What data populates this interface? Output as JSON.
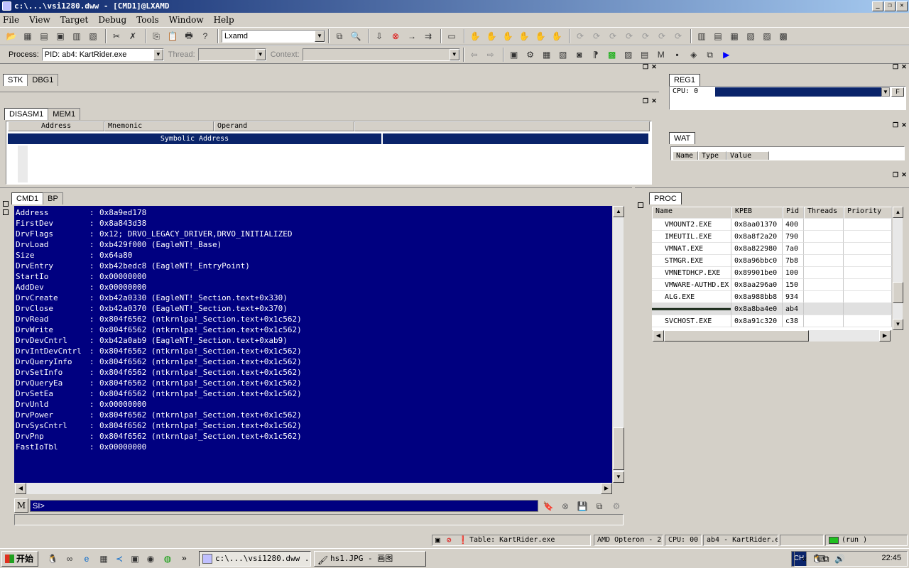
{
  "window": {
    "title": "c:\\...\\vsi1280.dww - [CMD1]@LXAMD"
  },
  "menu": [
    "File",
    "View",
    "Target",
    "Debug",
    "Tools",
    "Window",
    "Help"
  ],
  "toolbar1": {
    "target_combo": "Lxamd"
  },
  "toolbar2": {
    "process_label": "Process:",
    "process_value": "PID:  ab4: KartRider.exe",
    "thread_label": "Thread:",
    "context_label": "Context:"
  },
  "stk_pane": {
    "tabs": [
      "STK",
      "DBG1"
    ]
  },
  "disasm_pane": {
    "tabs": [
      "DISASM1",
      "MEM1"
    ],
    "columns": [
      "Address",
      "Mnemonic",
      "Operand"
    ],
    "symbolic_header": "Symbolic Address"
  },
  "reg_pane": {
    "tab": "REG1",
    "cpu_label": "CPU:  0",
    "f_button": "F"
  },
  "wat_pane": {
    "tab": "WAT",
    "columns": [
      "Name",
      "Type",
      "Value"
    ]
  },
  "cmd_pane": {
    "tabs": [
      "CMD1",
      "BP"
    ],
    "lines": [
      {
        "key": "Address",
        "value": "0x8a9ed178"
      },
      {
        "key": "FirstDev",
        "value": "0x8a843d38"
      },
      {
        "key": "DrvFlags",
        "value": "0x12; DRVO_LEGACY_DRIVER,DRVO_INITIALIZED"
      },
      {
        "key": "DrvLoad",
        "value": "0xb429f000 (EagleNT!_Base)"
      },
      {
        "key": "Size",
        "value": "0x64a80"
      },
      {
        "key": "DrvEntry",
        "value": "0xb42bedc8 (EagleNT!_EntryPoint)"
      },
      {
        "key": "StartIo",
        "value": "0x00000000"
      },
      {
        "key": "AddDev",
        "value": "0x00000000"
      },
      {
        "key": "DrvCreate",
        "value": "0xb42a0330 (EagleNT!_Section.text+0x330)"
      },
      {
        "key": "DrvClose",
        "value": "0xb42a0370 (EagleNT!_Section.text+0x370)"
      },
      {
        "key": "DrvRead",
        "value": "0x804f6562 (ntkrnlpa!_Section.text+0x1c562)"
      },
      {
        "key": "DrvWrite",
        "value": "0x804f6562 (ntkrnlpa!_Section.text+0x1c562)"
      },
      {
        "key": "DrvDevCntrl",
        "value": "0xb42a0ab9 (EagleNT!_Section.text+0xab9)"
      },
      {
        "key": "DrvIntDevCntrl",
        "value": "0x804f6562 (ntkrnlpa!_Section.text+0x1c562)"
      },
      {
        "key": "DrvQueryInfo",
        "value": "0x804f6562 (ntkrnlpa!_Section.text+0x1c562)"
      },
      {
        "key": "DrvSetInfo",
        "value": "0x804f6562 (ntkrnlpa!_Section.text+0x1c562)"
      },
      {
        "key": "DrvQueryEa",
        "value": "0x804f6562 (ntkrnlpa!_Section.text+0x1c562)"
      },
      {
        "key": "DrvSetEa",
        "value": "0x804f6562 (ntkrnlpa!_Section.text+0x1c562)"
      },
      {
        "key": "DrvUnld",
        "value": "0x00000000"
      },
      {
        "key": "DrvPower",
        "value": "0x804f6562 (ntkrnlpa!_Section.text+0x1c562)"
      },
      {
        "key": "DrvSysCntrl",
        "value": "0x804f6562 (ntkrnlpa!_Section.text+0x1c562)"
      },
      {
        "key": "DrvPnp",
        "value": "0x804f6562 (ntkrnlpa!_Section.text+0x1c562)"
      },
      {
        "key": "FastIoTbl",
        "value": "0x00000000"
      }
    ],
    "separator": ":",
    "input_value": "SI>",
    "m_button": "M"
  },
  "proc_pane": {
    "tab": "PROC",
    "columns": [
      "Name",
      "KPEB",
      "Pid",
      "Threads",
      "Priority"
    ],
    "rows": [
      {
        "name": "VMOUNT2.EXE",
        "kpeb": "0x8aa01370",
        "pid": "400"
      },
      {
        "name": "IMEUTIL.EXE",
        "kpeb": "0x8a8f2a20",
        "pid": "790"
      },
      {
        "name": "VMNAT.EXE",
        "kpeb": "0x8a822980",
        "pid": "7a0"
      },
      {
        "name": "STMGR.EXE",
        "kpeb": "0x8a96bbc0",
        "pid": "7b8"
      },
      {
        "name": "VMNETDHCP.EXE",
        "kpeb": "0x89901be0",
        "pid": "100"
      },
      {
        "name": "VMWARE-AUTHD.EX",
        "kpeb": "0x8aa296a0",
        "pid": "150"
      },
      {
        "name": "ALG.EXE",
        "kpeb": "0x8a988bb8",
        "pid": "934"
      },
      {
        "name": "",
        "kpeb": "0x8a8ba4e0",
        "pid": "ab4"
      },
      {
        "name": "SVCHOST.EXE",
        "kpeb": "0x8a91c320",
        "pid": "c38"
      }
    ]
  },
  "statusbar": {
    "table": "Table: KartRider.exe",
    "cpu_model": "AMD Opteron - 2",
    "cpu": "CPU: 00",
    "process": "ab4 - KartRider.e",
    "state": "(run )"
  },
  "taskbar": {
    "start": "开始",
    "tasks": [
      "c:\\...\\vsi1280.dww ...",
      "hs1.JPG - 画图"
    ],
    "lang": "CH",
    "clock": "22:45",
    "quicklaunch_more": "»"
  },
  "colors": {
    "console_bg": "#000080",
    "title_start": "#0a246a",
    "title_end": "#a6caf0",
    "face": "#d4d0c8"
  }
}
